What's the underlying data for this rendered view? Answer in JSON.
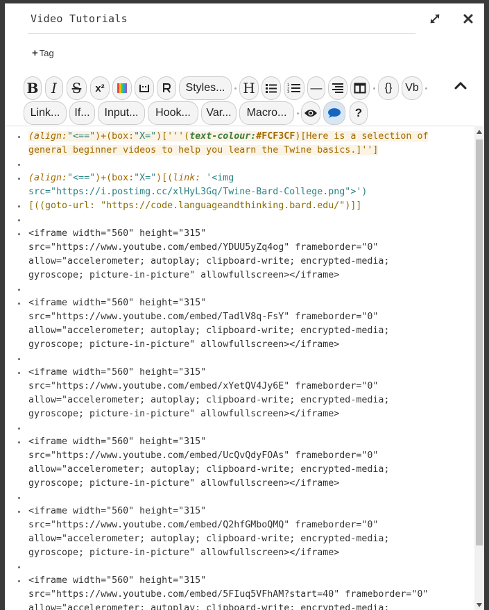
{
  "header": {
    "title": "Video Tutorials",
    "tag_label": "Tag",
    "expand_icon": "expand-arrows-icon",
    "close_icon": "close-icon"
  },
  "toolbar": {
    "row1": [
      {
        "name": "bold-button",
        "label": "B"
      },
      {
        "name": "italic-button",
        "label": "I"
      },
      {
        "name": "strikethrough-button",
        "label": "S"
      },
      {
        "name": "superscript-button",
        "label": "x²"
      },
      {
        "name": "colour-button",
        "label": ""
      },
      {
        "name": "collapse-button",
        "label": ""
      },
      {
        "name": "special-button",
        "label": ""
      },
      {
        "name": "styles-button",
        "label": "Styles..."
      },
      {
        "name": "heading-button",
        "label": "H"
      },
      {
        "name": "bullet-list-button",
        "label": ""
      },
      {
        "name": "numbered-list-button",
        "label": ""
      },
      {
        "name": "hr-button",
        "label": "—"
      },
      {
        "name": "align-button",
        "label": ""
      },
      {
        "name": "columns-button",
        "label": ""
      },
      {
        "name": "verbatim-braces-button",
        "label": "{}"
      },
      {
        "name": "vb-button",
        "label": "Vb"
      }
    ],
    "row2": [
      {
        "name": "link-button",
        "label": "Link..."
      },
      {
        "name": "if-button",
        "label": "If..."
      },
      {
        "name": "input-button",
        "label": "Input..."
      },
      {
        "name": "hook-button",
        "label": "Hook..."
      },
      {
        "name": "var-button",
        "label": "Var..."
      },
      {
        "name": "macro-button",
        "label": "Macro..."
      },
      {
        "name": "preview-button",
        "label": ""
      },
      {
        "name": "comment-button",
        "label": ""
      },
      {
        "name": "help-button",
        "label": "?"
      }
    ]
  },
  "editor": {
    "lines": [
      "general beginner videos to help you learn the Twine basics.]'']",
      "src=\"https://i.postimg.cc/xlHyL3Gq/Twine-Bard-College.png\">')",
      "[((goto-url: \"https://code.languageandthinking.bard.edu/\")]]",
      "<iframe width=\"560\" height=\"315\"",
      "src=\"https://www.youtube.com/embed/YDUU5yZq4og\" frameborder=\"0\"",
      "allow=\"accelerometer; autoplay; clipboard-write; encrypted-media;",
      "gyroscope; picture-in-picture\" allowfullscreen></iframe>",
      "src=\"https://www.youtube.com/embed/TadlV8q-FsY\" frameborder=\"0\"",
      "src=\"https://www.youtube.com/embed/xYetQV4Jy6E\" frameborder=\"0\"",
      "src=\"https://www.youtube.com/embed/UcQvQdyFOAs\" frameborder=\"0\"",
      "src=\"https://www.youtube.com/embed/Q2hfGMboQMQ\" frameborder=\"0\"",
      "src=\"https://www.youtube.com/embed/5FIuq5VFhAM?start=40\" frameborder=\"0\"",
      "allow=\"accelerometer; autoplay; clipboard-write; encrypted-media;"
    ],
    "first_line": {
      "p1": "(align:",
      "p2": "\"<==\"",
      "p3": ")+(box:",
      "p4": "\"X=\"",
      "p5": ")['''(",
      "p6": "text-colour:",
      "p7": "#FCF3CF",
      "p8": ")[Here is a selection of"
    },
    "link_line": {
      "p1": "(align:",
      "p2": "\"<==\"",
      "p3": ")+(box:",
      "p4": "\"X=\"",
      "p5": ")[(",
      "p6": "link: ",
      "p7": "'<img"
    }
  },
  "colors": {
    "highlight": "#fbf3e3",
    "macro": "#a06a00",
    "string": "#2a8080"
  }
}
